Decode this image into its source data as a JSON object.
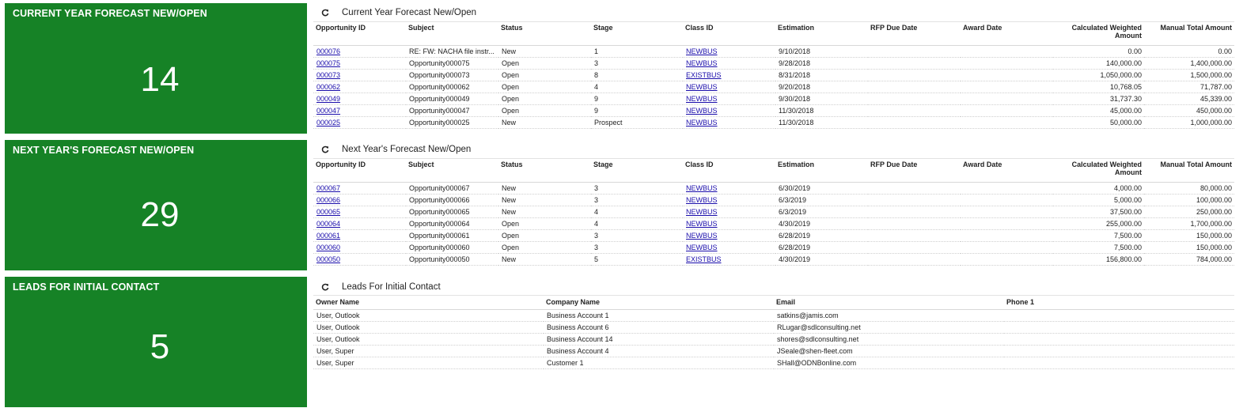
{
  "tiles": [
    {
      "title": "CURRENT YEAR FORECAST NEW/OPEN",
      "value": "14"
    },
    {
      "title": "NEXT YEAR'S FORECAST NEW/OPEN",
      "value": "29"
    },
    {
      "title": "LEADS FOR INITIAL CONTACT",
      "value": "5"
    }
  ],
  "current": {
    "title": "Current Year Forecast New/Open",
    "columns": [
      "Opportunity ID",
      "Subject",
      "Status",
      "Stage",
      "Class ID",
      "Estimation",
      "RFP Due Date",
      "Award Date",
      "Calculated Weighted Amount",
      "Manual Total Amount"
    ],
    "rows": [
      [
        "000076",
        "RE: FW: NACHA file instr...",
        "New",
        "1",
        "NEWBUS",
        "9/10/2018",
        "",
        "",
        "0.00",
        "0.00"
      ],
      [
        "000075",
        "Opportunity000075",
        "Open",
        "3",
        "NEWBUS",
        "9/28/2018",
        "",
        "",
        "140,000.00",
        "1,400,000.00"
      ],
      [
        "000073",
        "Opportunity000073",
        "Open",
        "8",
        "EXISTBUS",
        "8/31/2018",
        "",
        "",
        "1,050,000.00",
        "1,500,000.00"
      ],
      [
        "000062",
        "Opportunity000062",
        "Open",
        "4",
        "NEWBUS",
        "9/20/2018",
        "",
        "",
        "10,768.05",
        "71,787.00"
      ],
      [
        "000049",
        "Opportunity000049",
        "Open",
        "9",
        "NEWBUS",
        "9/30/2018",
        "",
        "",
        "31,737.30",
        "45,339.00"
      ],
      [
        "000047",
        "Opportunity000047",
        "Open",
        "9",
        "NEWBUS",
        "11/30/2018",
        "",
        "",
        "45,000.00",
        "450,000.00"
      ],
      [
        "000025",
        "Opportunity000025",
        "New",
        "Prospect",
        "NEWBUS",
        "11/30/2018",
        "",
        "",
        "50,000.00",
        "1,000,000.00"
      ]
    ]
  },
  "next": {
    "title": "Next Year's Forecast New/Open",
    "columns": [
      "Opportunity ID",
      "Subject",
      "Status",
      "Stage",
      "Class ID",
      "Estimation",
      "RFP Due Date",
      "Award Date",
      "Calculated Weighted Amount",
      "Manual Total Amount"
    ],
    "rows": [
      [
        "000067",
        "Opportunity000067",
        "New",
        "3",
        "NEWBUS",
        "6/30/2019",
        "",
        "",
        "4,000.00",
        "80,000.00"
      ],
      [
        "000066",
        "Opportunity000066",
        "New",
        "3",
        "NEWBUS",
        "6/3/2019",
        "",
        "",
        "5,000.00",
        "100,000.00"
      ],
      [
        "000065",
        "Opportunity000065",
        "New",
        "4",
        "NEWBUS",
        "6/3/2019",
        "",
        "",
        "37,500.00",
        "250,000.00"
      ],
      [
        "000064",
        "Opportunity000064",
        "Open",
        "4",
        "NEWBUS",
        "4/30/2019",
        "",
        "",
        "255,000.00",
        "1,700,000.00"
      ],
      [
        "000061",
        "Opportunity000061",
        "Open",
        "3",
        "NEWBUS",
        "6/28/2019",
        "",
        "",
        "7,500.00",
        "150,000.00"
      ],
      [
        "000060",
        "Opportunity000060",
        "Open",
        "3",
        "NEWBUS",
        "6/28/2019",
        "",
        "",
        "7,500.00",
        "150,000.00"
      ],
      [
        "000050",
        "Opportunity000050",
        "New",
        "5",
        "EXISTBUS",
        "4/30/2019",
        "",
        "",
        "156,800.00",
        "784,000.00"
      ]
    ]
  },
  "leads": {
    "title": "Leads For Initial Contact",
    "columns": [
      "Owner Name",
      "Company Name",
      "Email",
      "Phone 1"
    ],
    "rows": [
      [
        "User, Outlook",
        "Business Account 1",
        "satkins@jamis.com",
        ""
      ],
      [
        "User, Outlook",
        "Business Account 6",
        "RLugar@sdlconsulting.net",
        ""
      ],
      [
        "User, Outlook",
        "Business Account 14",
        "shores@sdlconsulting.net",
        ""
      ],
      [
        "User, Super",
        "Business Account 4",
        "JSeale@shen-fleet.com",
        ""
      ],
      [
        "User, Super",
        "Customer 1",
        "SHall@ODNBonline.com",
        ""
      ]
    ]
  },
  "colors": {
    "tile_green": "#168226",
    "link_blue": "#1a0dab"
  }
}
